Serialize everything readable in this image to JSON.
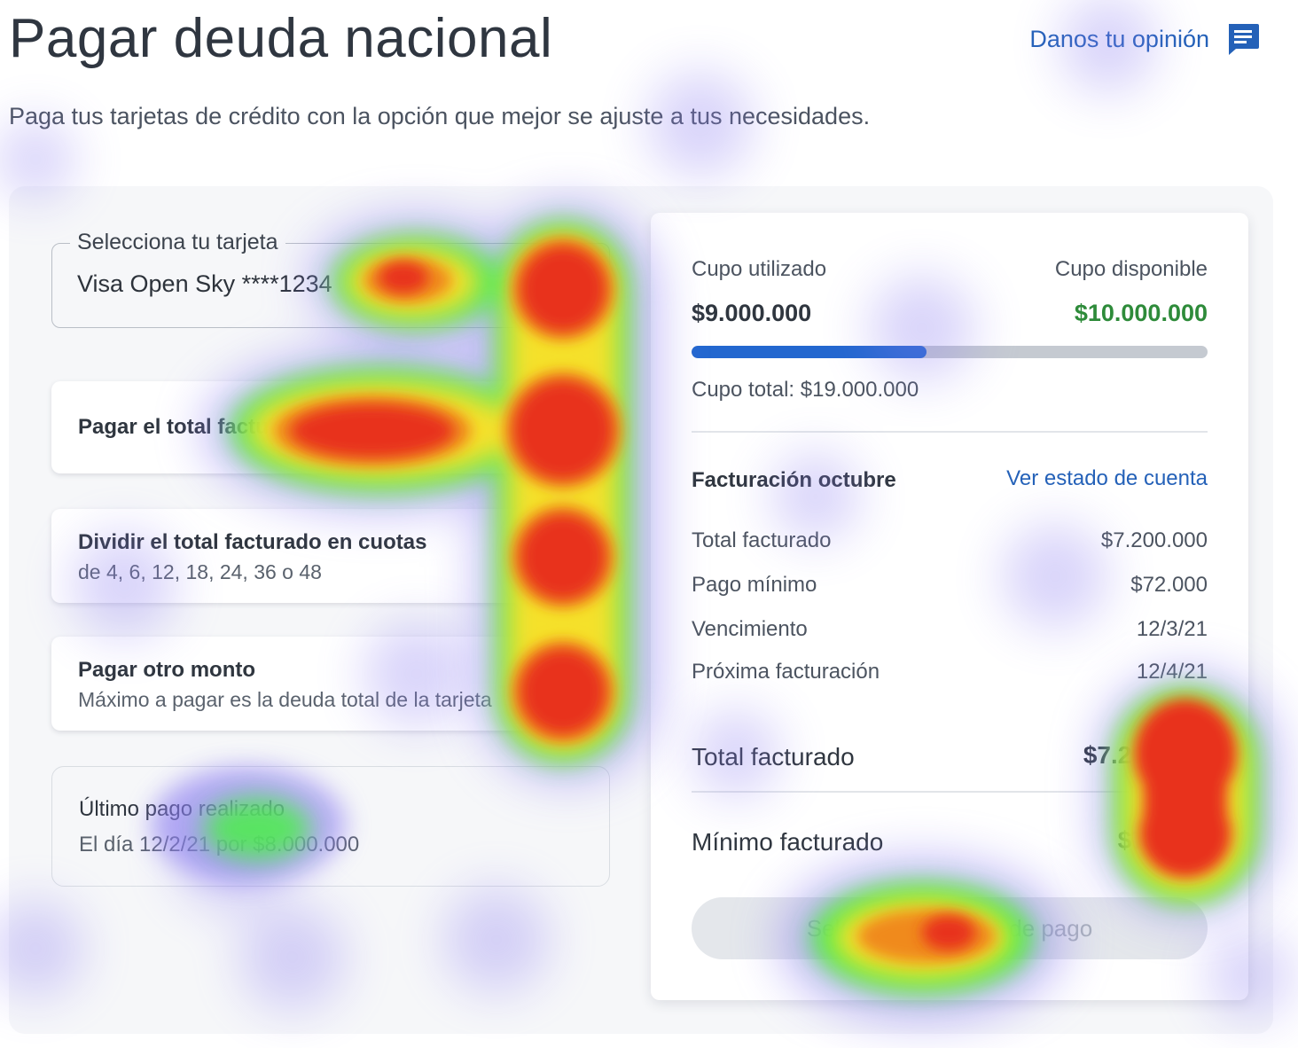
{
  "header": {
    "title": "Pagar deuda nacional",
    "feedback_label": "Danos tu opinión",
    "feedback_icon": "chat-feedback-icon",
    "subtitle": "Paga tus tarjetas de crédito con la opción que mejor se ajuste a tus necesidades."
  },
  "card_select": {
    "label": "Selecciona tu tarjeta",
    "value": "Visa Open Sky ****1234"
  },
  "payment_options": [
    {
      "title": "Pagar el total facturado o mínimo",
      "subtitle": ""
    },
    {
      "title": "Dividir el total facturado en cuotas",
      "subtitle": "de 4, 6, 12, 18, 24, 36 o 48"
    },
    {
      "title": "Pagar otro monto",
      "subtitle": "Máximo a pagar es la deuda total de la tarjeta"
    }
  ],
  "last_payment": {
    "title": "Último pago realizado",
    "detail": "El día 12/2/21 por $8.000.000"
  },
  "summary": {
    "used_label": "Cupo utilizado",
    "used_value": "$9.000.000",
    "available_label": "Cupo disponible",
    "available_value": "$10.000.000",
    "usage_fraction": 0.455,
    "total_quota": "Cupo total: $19.000.000",
    "billing_title": "Facturación octubre",
    "statement_link": "Ver estado de cuenta",
    "rows": [
      {
        "label": "Total facturado",
        "value": "$7.200.000"
      },
      {
        "label": "Pago mínimo",
        "value": "$72.000"
      },
      {
        "label": "Vencimiento",
        "value": "12/3/21"
      },
      {
        "label": "Próxima facturación",
        "value": "12/4/21"
      }
    ],
    "total_billed_label": "Total facturado",
    "total_billed_value": "$7.200.000",
    "minimum_billed_label": "Mínimo facturado",
    "minimum_billed_value": "$72.000",
    "cta_label": "Selecciona método de pago"
  },
  "colors": {
    "accent_blue": "#2461b8",
    "progress_fill": "#2367cf",
    "available_green": "#2e8b3a",
    "heat_hot": "#e8301c",
    "heat_warm": "#f5e12a",
    "heat_mid": "#4cf04a",
    "heat_cool": "#9b8bf2"
  }
}
